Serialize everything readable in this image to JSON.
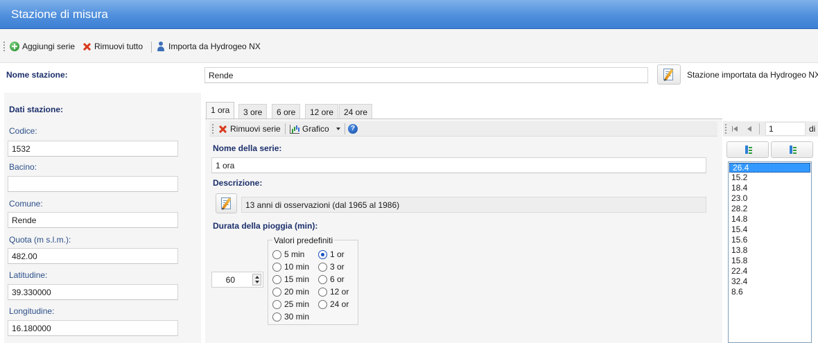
{
  "window": {
    "title": "Stazione di misura"
  },
  "toolbar": {
    "add_series": "Aggiungi serie",
    "remove_all": "Rimuovi tutto",
    "import_hydrogeo": "Importa da Hydrogeo NX"
  },
  "station": {
    "name_label": "Nome stazione:",
    "name_value": "Rende",
    "import_note": "Stazione importata da Hydrogeo NX"
  },
  "station_data": {
    "header": "Dati stazione:",
    "fields": [
      {
        "label": "Codice:",
        "value": "1532"
      },
      {
        "label": "Bacino:",
        "value": ""
      },
      {
        "label": "Comune:",
        "value": "Rende"
      },
      {
        "label": "Quota (m s.l.m.):",
        "value": "482.00"
      },
      {
        "label": "Latitudine:",
        "value": "39.330000"
      },
      {
        "label": "Longitudine:",
        "value": "16.180000"
      }
    ]
  },
  "tabs": [
    "1 ora",
    "3 ore",
    "6 ore",
    "12 ore",
    "24 ore"
  ],
  "series_toolbar": {
    "remove_series": "Rimuovi serie",
    "chart": "Grafico",
    "help": "?"
  },
  "series": {
    "name_label": "Nome della serie:",
    "name_value": "1 ora",
    "description_label": "Descrizione:",
    "description_value": "13 anni di osservazioni (dal 1965 al 1986)",
    "duration_label": "Durata della pioggia (min):",
    "duration_value": "60",
    "presets_caption": "Valori predefiniti",
    "presets_left": [
      "5 min",
      "10 min",
      "15 min",
      "20 min",
      "25 min",
      "30 min"
    ],
    "presets_right": [
      "1 or",
      "3 or",
      "6 or",
      "12 or",
      "24 or"
    ],
    "selected_preset": "1 or"
  },
  "pager": {
    "page": "1",
    "of_label": "di"
  },
  "values": [
    "26.4",
    "15.2",
    "18.4",
    "23.0",
    "28.2",
    "14.8",
    "15.4",
    "15.6",
    "13.8",
    "15.8",
    "22.4",
    "32.4",
    "8.6"
  ],
  "selected_value_index": 0
}
